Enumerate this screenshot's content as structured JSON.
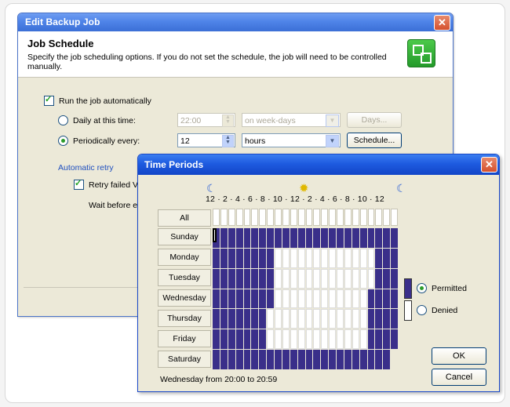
{
  "backup_window": {
    "title": "Edit Backup Job",
    "close_glyph": "✕",
    "header_title": "Job Schedule",
    "header_desc": "Specify the job scheduling options. If you do not set the schedule, the job will need to be controlled manually.",
    "run_auto_label": "Run the job automatically",
    "daily_label": "Daily at this time:",
    "daily_time": "22:00",
    "daily_days_select": "on week-days",
    "days_button": "Days...",
    "periodic_label": "Periodically every:",
    "periodic_value": "12",
    "periodic_unit": "hours",
    "schedule_button": "Schedule...",
    "retry_group": "Automatic retry",
    "retry_label": "Retry failed V",
    "wait_label": "Wait before e"
  },
  "time_periods": {
    "title": "Time Periods",
    "close_glyph": "✕",
    "hour_labels": "12 · 2 · 4 · 6 · 8 · 10 · 12 · 2 · 4 · 6 · 8 · 10 · 12",
    "all_label": "All",
    "days": [
      "Sunday",
      "Monday",
      "Tuesday",
      "Wednesday",
      "Thursday",
      "Friday",
      "Saturday"
    ],
    "permitted_label": "Permitted",
    "denied_label": "Denied",
    "status": "Wednesday from 20:00 to 20:59",
    "ok_button": "OK",
    "cancel_button": "Cancel",
    "colors": {
      "permitted": "#3a2f8a",
      "denied": "#ffffff"
    },
    "schedule_grid": [
      [
        1,
        1,
        1,
        1,
        1,
        1,
        1,
        1,
        1,
        1,
        1,
        1,
        1,
        1,
        1,
        1,
        1,
        1,
        1,
        1,
        1,
        1,
        1,
        1
      ],
      [
        1,
        1,
        1,
        1,
        1,
        1,
        1,
        1,
        0,
        0,
        0,
        0,
        0,
        0,
        0,
        0,
        0,
        0,
        0,
        0,
        0,
        1,
        1,
        1
      ],
      [
        1,
        1,
        1,
        1,
        1,
        1,
        1,
        1,
        0,
        0,
        0,
        0,
        0,
        0,
        0,
        0,
        0,
        0,
        0,
        0,
        0,
        1,
        1,
        1
      ],
      [
        1,
        1,
        1,
        1,
        1,
        1,
        1,
        1,
        0,
        0,
        0,
        0,
        0,
        0,
        0,
        0,
        0,
        0,
        0,
        0,
        1,
        1,
        1,
        1
      ],
      [
        1,
        1,
        1,
        1,
        1,
        1,
        1,
        1,
        0,
        0,
        0,
        0,
        0,
        0,
        0,
        0,
        0,
        0,
        0,
        0,
        0,
        1,
        1,
        1
      ],
      [
        1,
        1,
        1,
        1,
        1,
        1,
        1,
        1,
        0,
        0,
        0,
        0,
        0,
        0,
        0,
        0,
        0,
        0,
        0,
        0,
        0,
        1,
        1,
        1
      ],
      [
        1,
        1,
        1,
        1,
        1,
        1,
        1,
        1,
        1,
        1,
        1,
        1,
        1,
        1,
        1,
        1,
        1,
        1,
        1,
        1,
        1,
        1,
        1,
        1
      ]
    ],
    "selected_cell": {
      "day": 3,
      "hour": 20
    }
  }
}
